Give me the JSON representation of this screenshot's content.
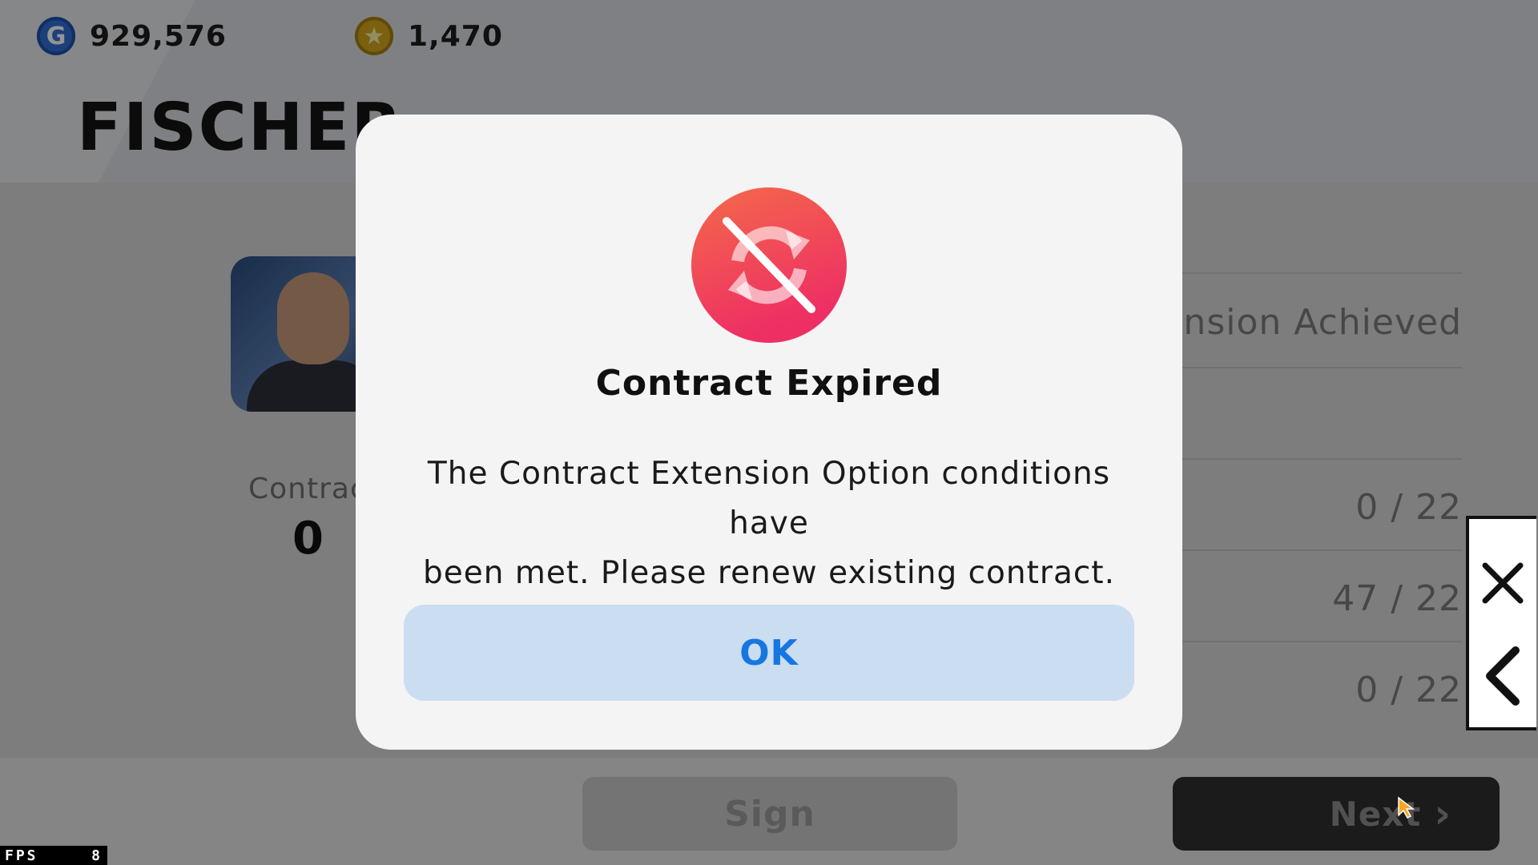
{
  "header": {
    "gp_amount": "929,576",
    "coin_amount": "1,470",
    "player_name": "FISCHER"
  },
  "background": {
    "contract_label": "Contrac",
    "contract_value": "0",
    "extension_label": "ension Achieved",
    "progress_rows": [
      "0 / 22",
      "47 / 22",
      "0 / 22"
    ],
    "sign_label": "Sign",
    "next_label": "Next"
  },
  "modal": {
    "title": "Contract Expired",
    "body_line1": "The Contract Extension Option conditions have",
    "body_line2": "been met. Please renew existing contract.",
    "ok_label": "OK",
    "icon": "contract-expired-icon"
  },
  "side_controls": {
    "icons": [
      "close-icon",
      "back-arrow-icon"
    ]
  },
  "fps": {
    "label": "FPS",
    "value": "8"
  },
  "colors": {
    "accent_blue": "#1677e0",
    "ok_bg": "#cbddf1",
    "alert_red": "#ee2f64",
    "alert_orange": "#f46a4a"
  }
}
